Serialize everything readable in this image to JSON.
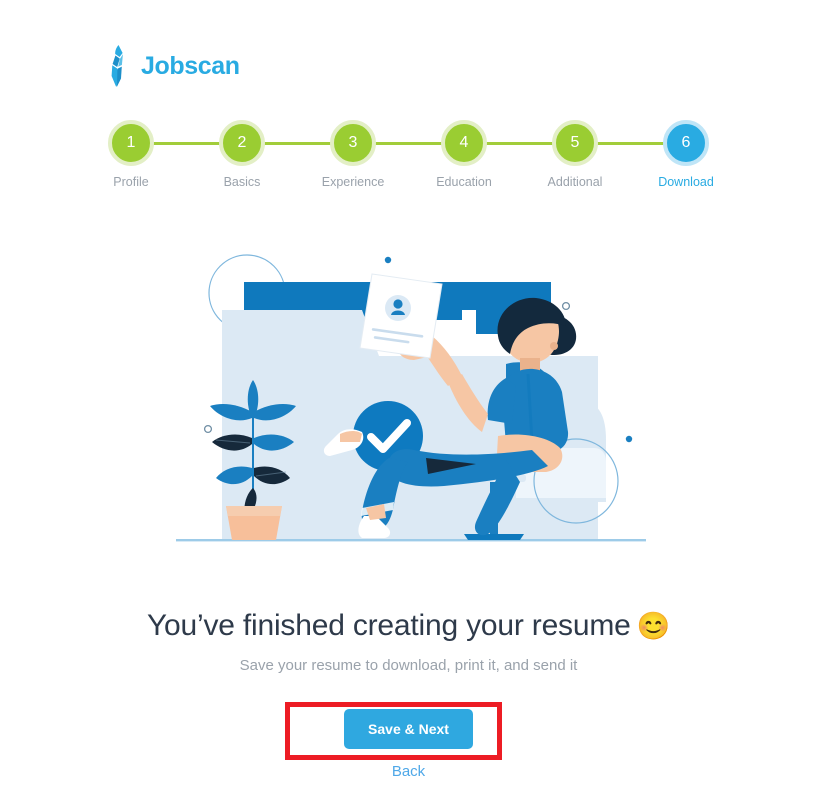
{
  "brand": {
    "name": "Jobscan",
    "mark_icon": "necktie-icon",
    "accent_color": "#29abe2"
  },
  "stepper": {
    "line_color": "#a2cd3a",
    "done_color": "#9acd32",
    "active_color": "#29abe2",
    "steps": [
      {
        "number": "1",
        "label": "Profile",
        "state": "done"
      },
      {
        "number": "2",
        "label": "Basics",
        "state": "done"
      },
      {
        "number": "3",
        "label": "Experience",
        "state": "done"
      },
      {
        "number": "4",
        "label": "Education",
        "state": "done"
      },
      {
        "number": "5",
        "label": "Additional",
        "state": "done"
      },
      {
        "number": "6",
        "label": "Download",
        "state": "active"
      }
    ]
  },
  "illustration": {
    "name": "resume-complete-illustration",
    "description": "Woman seated in an office chair holding a resume page beside a large folder, a potted plant and a blue check-circle",
    "colors": {
      "folder_back": "#0f79bd",
      "folder_front": "#dce9f4",
      "panel": "#dce9f4",
      "check_circle": "#0e7ac0",
      "skin": "#f6c6a4",
      "hair": "#13293d",
      "clothes": "#1a7fc1",
      "pot": "#f7bf9a",
      "ground_line": "#9dcbe8"
    }
  },
  "main": {
    "headline": "You’ve finished creating your resume",
    "headline_emoji": "😊",
    "subhead": "Save your resume to download, print it, and send it"
  },
  "actions": {
    "primary_label": "Save & Next",
    "primary_color": "#2fa8e0",
    "back_label": "Back",
    "back_color": "#4fa8e8",
    "highlight_color": "#ed1c24"
  }
}
